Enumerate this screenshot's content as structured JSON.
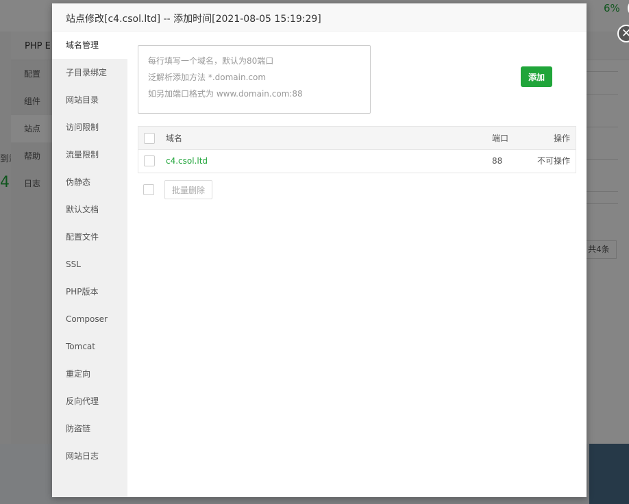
{
  "background": {
    "percent": "6%",
    "side_digit": "4",
    "side_text": "到站",
    "panel_title": "PHP E",
    "menu": [
      "配置",
      "组件",
      "站点",
      "帮助",
      "日志"
    ],
    "total_count": "共4条"
  },
  "dialog": {
    "title": "站点修改[c4.csol.ltd] -- 添加时间[2021-08-05 15:19:29]",
    "close_glyph": "✕",
    "nav": [
      "域名管理",
      "子目录绑定",
      "网站目录",
      "访问限制",
      "流量限制",
      "伪静态",
      "默认文档",
      "配置文件",
      "SSL",
      "PHP版本",
      "Composer",
      "Tomcat",
      "重定向",
      "反向代理",
      "防盗链",
      "网站日志"
    ],
    "domain_input": {
      "placeholder_lines": [
        "每行填写一个域名，默认为80端口",
        "泛解析添加方法 *.domain.com",
        "如另加端口格式为 www.domain.com:88"
      ]
    },
    "add_label": "添加",
    "table": {
      "headers": {
        "domain": "域名",
        "port": "端口",
        "operation": "操作"
      },
      "rows": [
        {
          "domain": "c4.csol.ltd",
          "port": "88",
          "operation": "不可操作"
        }
      ]
    },
    "batch_delete_label": "批量删除"
  },
  "colors": {
    "accent": "#20a53a",
    "header_bg": "#f8f8f8",
    "nav_bg": "#f0f0f0"
  }
}
